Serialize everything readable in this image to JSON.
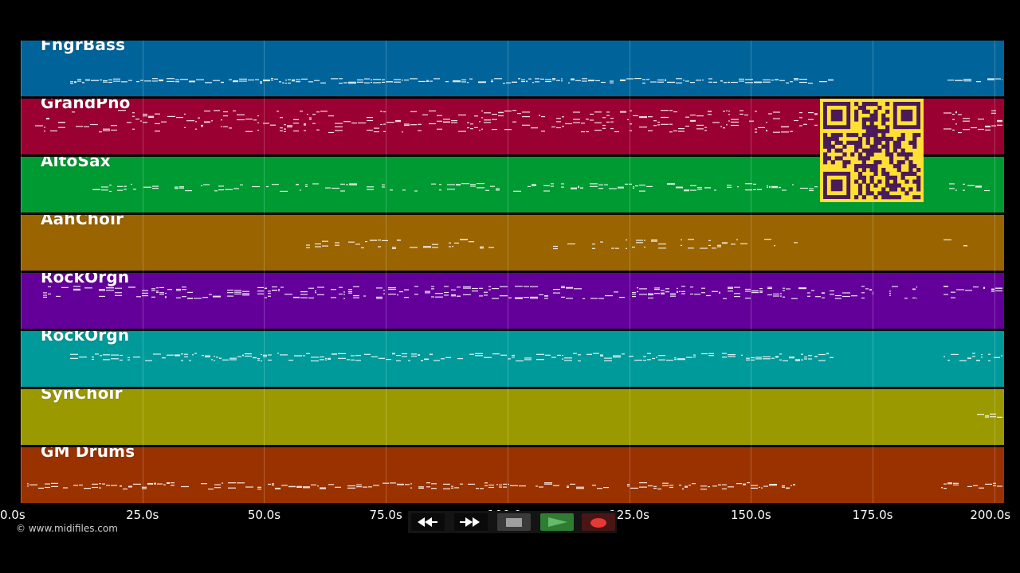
{
  "window": {
    "copyright": "© www.midifiles.com"
  },
  "tracks": [
    {
      "name": "FngrBass",
      "color": "#00649a"
    },
    {
      "name": "GrandPno",
      "color": "#9a0032"
    },
    {
      "name": "AltoSax",
      "color": "#009a32"
    },
    {
      "name": "AahChoir",
      "color": "#9a6400"
    },
    {
      "name": "RockOrgn",
      "color": "#64009a"
    },
    {
      "name": "RockOrgn",
      "color": "#009a9a"
    },
    {
      "name": "SynChoir",
      "color": "#9a9a00"
    },
    {
      "name": "GM Drums",
      "color": "#9a3200"
    }
  ],
  "timeline": {
    "min": 0,
    "max": 202,
    "ticks": [
      {
        "value": 0,
        "label": "0.0s"
      },
      {
        "value": 25,
        "label": "25.0s"
      },
      {
        "value": 50,
        "label": "50.0s"
      },
      {
        "value": 75,
        "label": "75.0s"
      },
      {
        "value": 100,
        "label": "100.0s"
      },
      {
        "value": 125,
        "label": "125.0s"
      },
      {
        "value": 150,
        "label": "150.0s"
      },
      {
        "value": 175,
        "label": "175.0s"
      },
      {
        "value": 200,
        "label": "200.0s"
      }
    ]
  },
  "transport": {
    "buttons": [
      {
        "id": "rewind",
        "icon": "rewind-icon"
      },
      {
        "id": "forward",
        "icon": "fast-forward-icon"
      },
      {
        "id": "stop",
        "icon": "stop-icon"
      },
      {
        "id": "play",
        "icon": "play-icon"
      },
      {
        "id": "record",
        "icon": "record-icon"
      }
    ]
  },
  "qr": {
    "icon": "qr-code",
    "color": "#ffe033",
    "dark_color": "#4a1a5a"
  }
}
